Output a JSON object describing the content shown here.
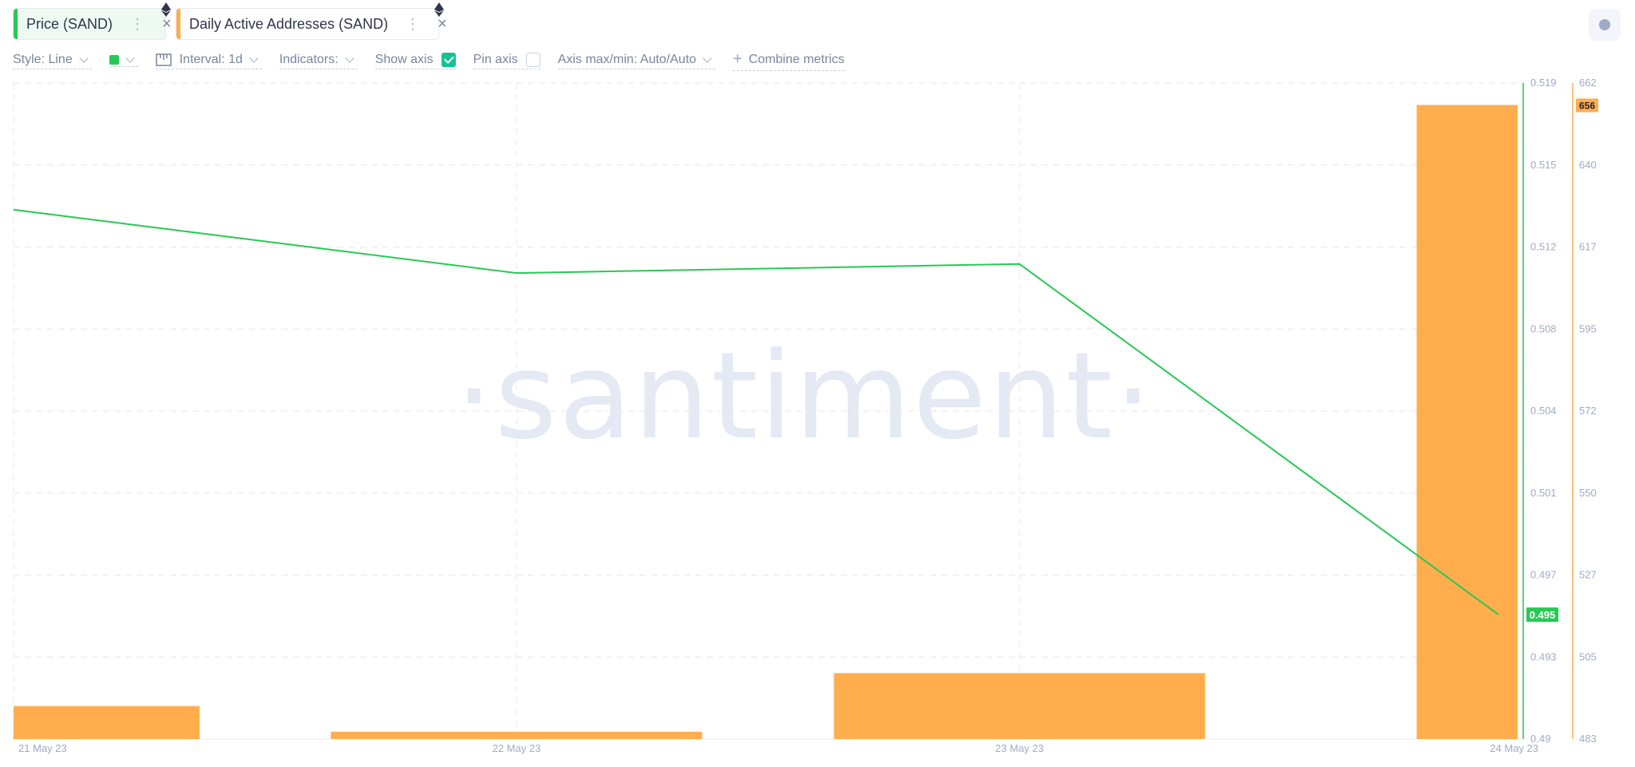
{
  "tabs": [
    {
      "label": "Price (SAND)",
      "color": "#26c953",
      "menu_icon": "more-vertical-icon",
      "close_icon": "close-icon",
      "badge_icon": "ethereum-icon"
    },
    {
      "label": "Daily Active Addresses (SAND)",
      "color": "#ffad4d",
      "menu_icon": "more-vertical-icon",
      "close_icon": "close-icon",
      "badge_icon": "ethereum-icon"
    }
  ],
  "toolbar": {
    "style_label": "Style: Line",
    "swatch_color": "#26c953",
    "interval_label": "Interval: 1d",
    "indicators_label": "Indicators:",
    "show_axis_label": "Show axis",
    "show_axis_checked": true,
    "pin_axis_label": "Pin axis",
    "pin_axis_checked": false,
    "axis_label": "Axis max/min: Auto/Auto",
    "combine_label": "Combine metrics"
  },
  "watermark": "·santiment·",
  "chart_data": {
    "type": "bar+line",
    "x": [
      "21 May 23",
      "22 May 23",
      "23 May 23",
      "24 May 23"
    ],
    "series": [
      {
        "name": "Price (SAND)",
        "type": "line",
        "color": "#26c953",
        "axis": "left",
        "values": [
          0.5134,
          0.5106,
          0.511,
          0.4955
        ]
      },
      {
        "name": "Daily Active Addresses (SAND)",
        "type": "bar",
        "color": "#ffad4d",
        "axis": "right",
        "values": [
          492,
          485,
          501,
          656
        ]
      }
    ],
    "price_axis": {
      "ticks": [
        "0.519",
        "0.515",
        "0.512",
        "0.508",
        "0.504",
        "0.501",
        "0.497",
        "0.493",
        "0.49"
      ],
      "range": [
        0.49,
        0.519
      ]
    },
    "daa_axis": {
      "ticks": [
        "662",
        "640",
        "617",
        "595",
        "572",
        "550",
        "527",
        "505",
        "483"
      ],
      "range": [
        483,
        662
      ]
    },
    "last_price_label": "0.495",
    "last_daa_label": "656",
    "grid": true
  }
}
